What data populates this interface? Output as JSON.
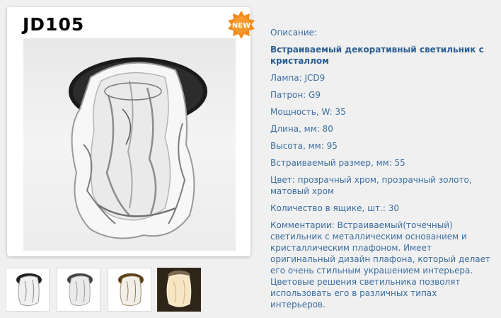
{
  "product": {
    "model": "JD105",
    "badge": "NEW"
  },
  "thumbnails": [
    {
      "name": "thumb-chrome-clear"
    },
    {
      "name": "thumb-chrome-matte"
    },
    {
      "name": "thumb-gold-clear"
    },
    {
      "name": "thumb-lit"
    }
  ],
  "specs": {
    "description_label": "Описание:",
    "title": "Встраиваемый декоративный светильник с кристаллом",
    "lamp": "Лампа: JCD9",
    "socket": "Патрон: G9",
    "power": "Мощность, W: 35",
    "length": "Длина, мм: 80",
    "height": "Высота, мм: 95",
    "cutout": "Встраиваемый размер, мм: 55",
    "color": "Цвет: прозрачный хром, прозрачный золото, матовый хром",
    "box_qty": "Количество в ящике, шт.: 30",
    "comments": "Комментарии: Встраиваемый(точечный) светильник с металлическим основанием и кристаллическим плафоном. Имеет оригинальный дизайн плафона, который делает его очень стильным украшением интерьера. Цветовые решения светильника позволят использовать его в различных типах интерьеров."
  },
  "colors": {
    "text": "#3b6ea0",
    "heading": "#2a5e94",
    "badge": "#f28a1c",
    "background": "#f0f0f0"
  }
}
